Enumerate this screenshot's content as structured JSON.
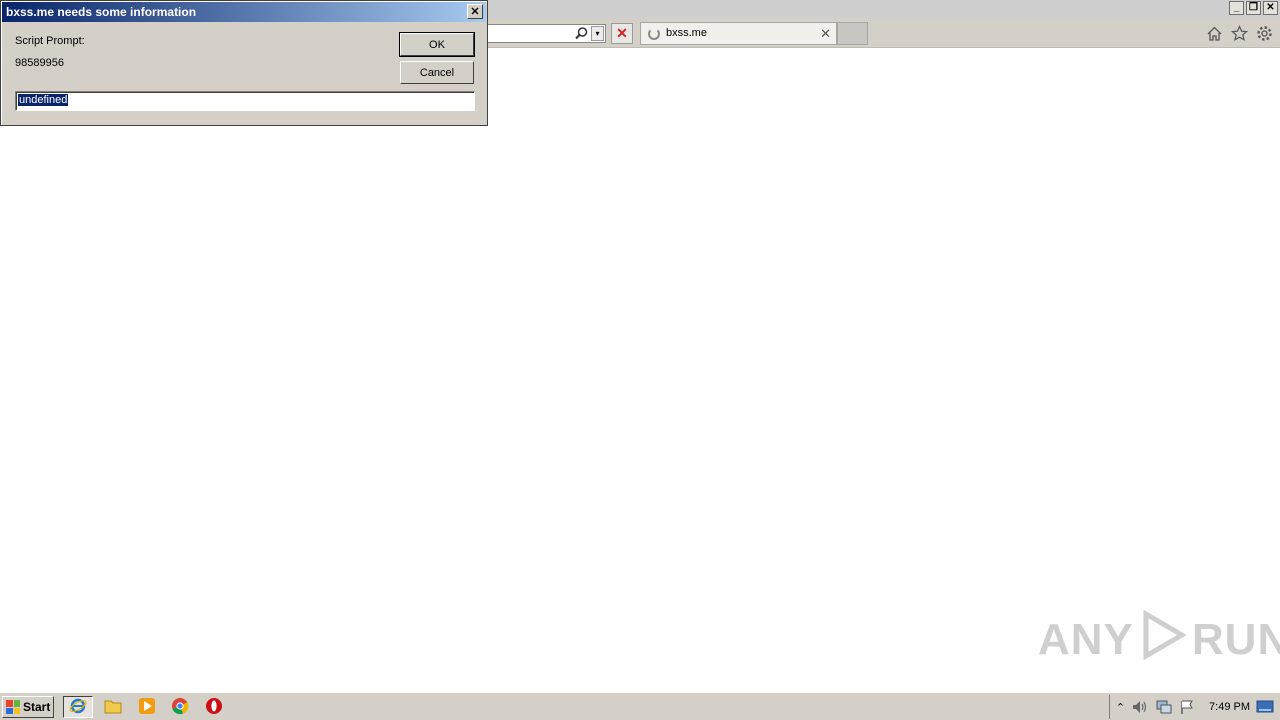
{
  "dialog": {
    "title": "bxss.me needs some information",
    "close": "✕",
    "label": "Script Prompt:",
    "message": "98589956",
    "ok": "OK",
    "cancel": "Cancel",
    "input_value": "undefined"
  },
  "browser": {
    "tab_title": "bxss.me",
    "tab_close": "✕",
    "stop": "✕",
    "address_dropdown": "▾",
    "window_controls": {
      "minimize": "_",
      "restore": "❐",
      "close": "✕"
    }
  },
  "watermark": {
    "left": "ANY",
    "right": "RUN"
  },
  "taskbar": {
    "start": "Start",
    "clock": "7:49 PM",
    "tray_arrow": "⌃"
  },
  "colors": {
    "dialog_title_start": "#0a246a",
    "dialog_title_end": "#a6caf0",
    "chrome": "#d4d0c8",
    "stop_red": "#d42020"
  }
}
